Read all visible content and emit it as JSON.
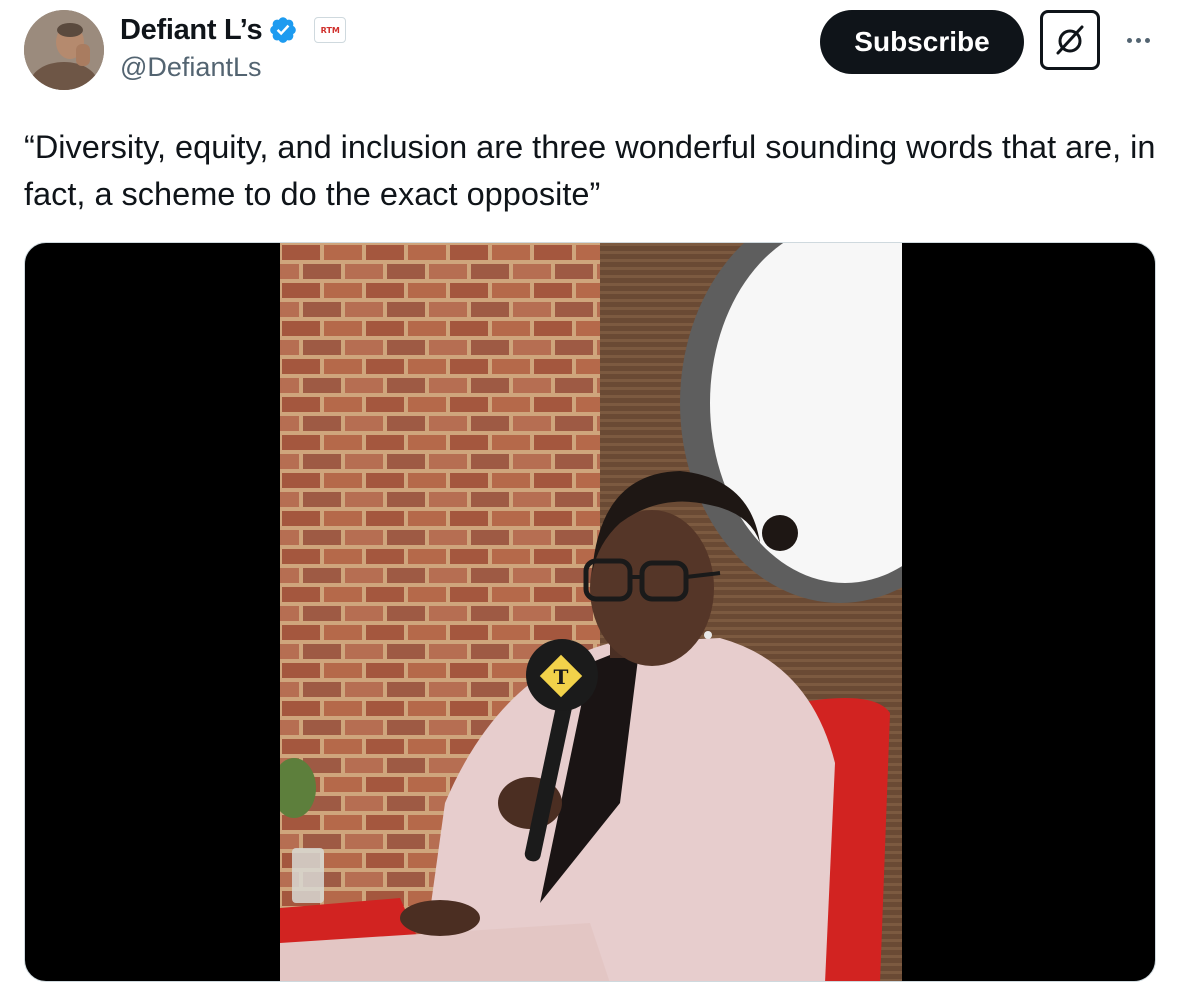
{
  "author": {
    "display_name": "Defiant L’s",
    "handle": "@DefiantLs",
    "verified_icon": "verified-badge-icon",
    "affiliate_badge_text": "RTM",
    "affiliate_badge_color": "#d0312d",
    "verified_color": "#1d9bf0"
  },
  "actions": {
    "subscribe_label": "Subscribe",
    "grok_icon": "grok-icon",
    "more_icon": "more-horizontal-icon"
  },
  "tweet": {
    "text": "“Diversity, equity, and inclusion are three wonderful sounding words that are, in fact, a scheme to do the exact opposite”"
  },
  "media": {
    "type": "video",
    "microphone_logo_text": "T"
  }
}
